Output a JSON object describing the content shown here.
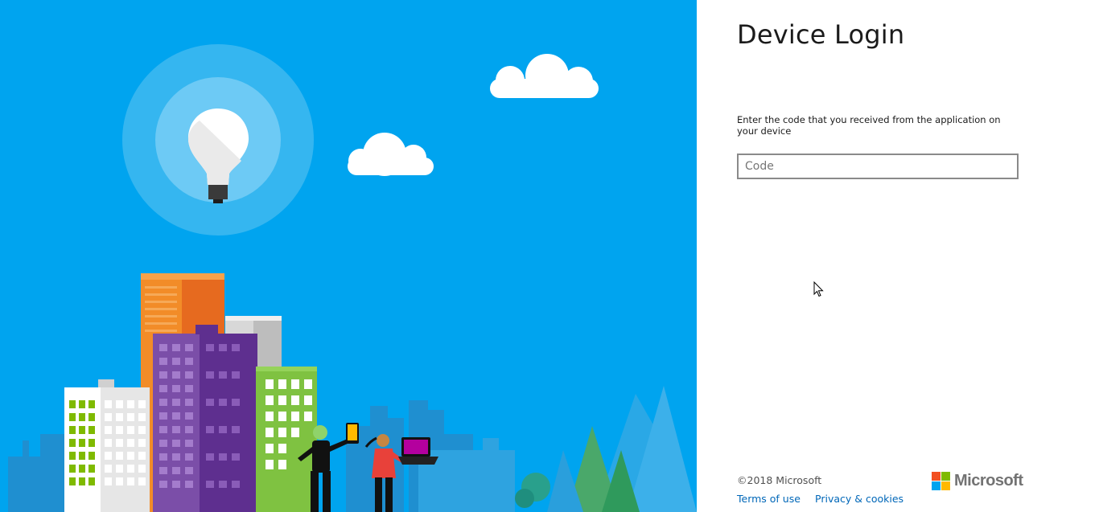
{
  "login": {
    "title": "Device Login",
    "instructions": "Enter the code that you received from the application on your device",
    "code_placeholder": "Code"
  },
  "footer": {
    "copyright": "©2018 Microsoft",
    "terms_label": "Terms of use",
    "privacy_label": "Privacy & cookies"
  },
  "brand": {
    "logo_text": "Microsoft",
    "logo_colors": [
      "#f25022",
      "#7fba00",
      "#00a4ef",
      "#ffb900"
    ],
    "hero_background": "#00a4ef",
    "link_color": "#0067b8"
  },
  "icons": [
    "lightbulb-icon",
    "cloud-icon",
    "city-skyline-illustration",
    "microsoft-logo-icon",
    "cursor-icon"
  ]
}
